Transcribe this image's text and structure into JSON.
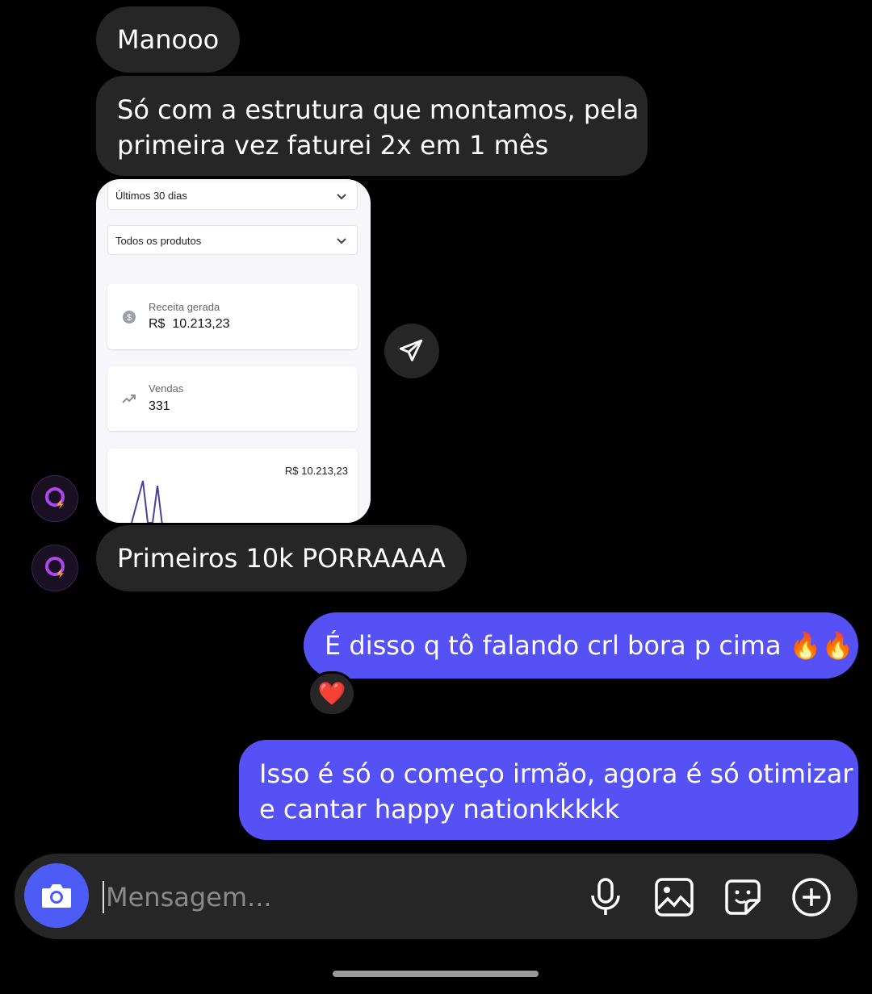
{
  "messages": {
    "m1": "Manooo",
    "m2_line1": "Só com a estrutura que montamos, pela",
    "m2_line2": "primeira vez faturei 2x em 1 mês",
    "m3": "Primeiros 10k PORRAAAA",
    "m4": "É disso q tô falando crl bora p cima 🔥🔥",
    "m4_reaction": "❤️",
    "m5_line1": "Isso é só o começo irmão, agora é só otimizar",
    "m5_line2": "e cantar happy nationkkkkk"
  },
  "shared_image": {
    "period_select": "Últimos 30 dias",
    "product_select": "Todos os produtos",
    "revenue_label": "Receita gerada",
    "revenue_value": "R$  10.213,23",
    "sales_label": "Vendas",
    "sales_value": "331",
    "chart_label": "R$ 10.213,23"
  },
  "composer": {
    "placeholder": "Mensagem..."
  },
  "colors": {
    "incoming_bubble": "#262626",
    "outgoing_bubble": "#5551f5",
    "background": "#000000"
  },
  "icons": [
    "share-icon",
    "avatar-logo-icon",
    "camera-icon",
    "microphone-icon",
    "gallery-icon",
    "sticker-icon",
    "plus-icon",
    "dollar-icon",
    "trend-icon",
    "chevron-down-icon"
  ]
}
